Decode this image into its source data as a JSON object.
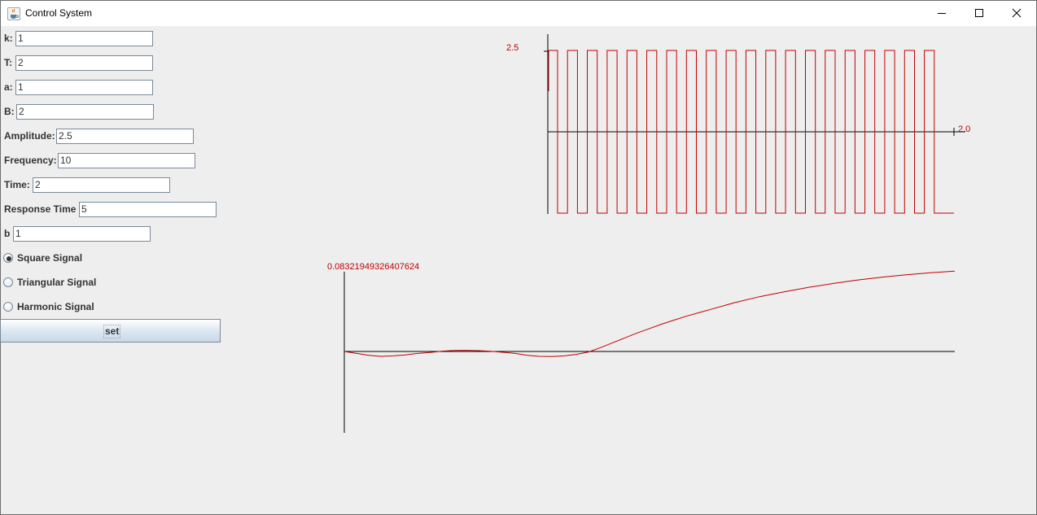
{
  "window": {
    "title": "Control System",
    "icon": "java-cup-icon",
    "controls": [
      "minimize-icon",
      "maximize-icon",
      "close-icon"
    ]
  },
  "form": {
    "fields": [
      {
        "label": "k:",
        "value": "1"
      },
      {
        "label": "T:",
        "value": "2"
      },
      {
        "label": "a:",
        "value": "1"
      },
      {
        "label": "B:",
        "value": "2"
      },
      {
        "label": "Amplitude:",
        "value": "2.5"
      },
      {
        "label": "Frequency:",
        "value": "10"
      },
      {
        "label": "Time:",
        "value": "2"
      },
      {
        "label": "Response Time",
        "value": "5"
      },
      {
        "label": "b",
        "value": "1"
      }
    ],
    "signals": [
      {
        "label": "Square Signal",
        "selected": true
      },
      {
        "label": "Triangular Signal",
        "selected": false
      },
      {
        "label": "Harmonic Signal",
        "selected": false
      }
    ],
    "set_label": "set"
  },
  "chart_data": [
    {
      "type": "line",
      "title": "",
      "signal": "square",
      "amplitude": 2.5,
      "frequency": 10,
      "time": 2.0,
      "x_range": [
        0,
        2.0
      ],
      "y_range": [
        -2.5,
        2.5
      ],
      "x_max_label": "2.0",
      "y_max_label": "2.5",
      "color": "#c00000"
    },
    {
      "type": "line",
      "title": "",
      "y_max_label": "0.08321949326407624",
      "y_max": 0.08321949326407624,
      "x_range": [
        0,
        5
      ],
      "series": [
        {
          "x": [
            0,
            0.1,
            0.2,
            0.3,
            0.4,
            0.5,
            0.6,
            0.7,
            0.8,
            0.9,
            1.0,
            1.1,
            1.2,
            1.3,
            1.4,
            1.5,
            1.6,
            1.7,
            1.8,
            1.9,
            2.0,
            2.1,
            2.2,
            2.3,
            2.4,
            2.5,
            2.6,
            2.7,
            2.8,
            2.9,
            3.0,
            3.2,
            3.4,
            3.6,
            3.8,
            4.0,
            4.2,
            4.4,
            4.6,
            4.8,
            5.0
          ],
          "y": [
            0,
            -0.002,
            -0.004,
            -0.005,
            -0.0045,
            -0.0035,
            -0.002,
            -0.001,
            0.0003,
            0.001,
            0.0012,
            0.0008,
            0.0002,
            -0.0008,
            -0.002,
            -0.004,
            -0.005,
            -0.0052,
            -0.0045,
            -0.003,
            -0.0005,
            0.004,
            0.009,
            0.014,
            0.019,
            0.0235,
            0.028,
            0.032,
            0.036,
            0.0395,
            0.043,
            0.05,
            0.056,
            0.061,
            0.0655,
            0.0695,
            0.073,
            0.076,
            0.0785,
            0.0805,
            0.0822
          ]
        }
      ],
      "color": "#c00000"
    }
  ]
}
